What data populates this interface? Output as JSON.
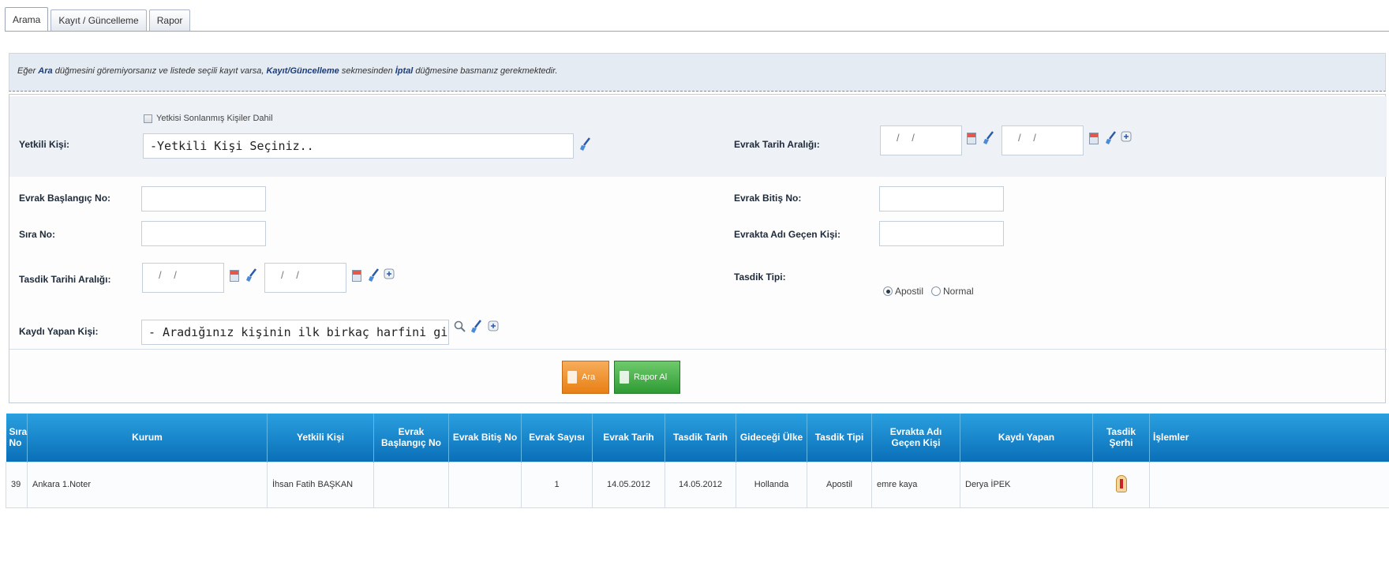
{
  "tabs": [
    "Arama",
    "Kayıt / Güncelleme",
    "Rapor"
  ],
  "info": {
    "t1": "Eğer ",
    "b1": "Ara",
    "t2": " düğmesini göremiyorsanız ve listede seçili kayıt varsa, ",
    "b2": "Kayıt/Güncelleme",
    "t3": " sekmesinden ",
    "b3": "İptal",
    "t4": " düğmesine basmanız gerekmektedir."
  },
  "form": {
    "yetkili_checkbox_label": "Yetkisi Sonlanmış Kişiler Dahil",
    "yetkili_label": "Yetkili Kişi:",
    "yetkili_value": "-Yetkili Kişi Seçiniz..",
    "evrak_tarih_label": "Evrak Tarih Aralığı:",
    "evrak_baslangic_label": "Evrak Başlangıç No:",
    "evrak_bitis_label": "Evrak Bitiş No:",
    "sira_label": "Sıra No:",
    "adi_gecen_label": "Evrakta Adı Geçen Kişi:",
    "tasdik_tarih_label": "Tasdik Tarihi Aralığı:",
    "tasdik_tipi_label": "Tasdik Tipi:",
    "tasdik_options": [
      "Apostil",
      "Normal"
    ],
    "tasdik_selected": "Apostil",
    "kaydi_yapan_label": "Kaydı Yapan Kişi:",
    "kaydi_yapan_value": "- Aradığınız kişinin ilk birkaç harfini giriniz...",
    "date_placeholder": "/ /"
  },
  "buttons": {
    "search": "Ara",
    "report": "Rapor Al"
  },
  "table": {
    "headers": [
      "Sıra No",
      "Kurum",
      "Yetkili Kişi",
      "Evrak Başlangıç No",
      "Evrak Bitiş No",
      "Evrak Sayısı",
      "Evrak Tarih",
      "Tasdik Tarih",
      "Gideceği Ülke",
      "Tasdik Tipi",
      "Evrakta Adı Geçen Kişi",
      "Kaydı Yapan",
      "Tasdik Şerhi",
      "İşlemler"
    ],
    "rows": [
      [
        "39",
        "Ankara 1.Noter",
        "İhsan Fatih BAŞKAN",
        "",
        "",
        "1",
        "14.05.2012",
        "14.05.2012",
        "Hollanda",
        "Apostil",
        "emre kaya",
        "Derya İPEK",
        "",
        ""
      ]
    ]
  },
  "icons": [
    "calendar-icon",
    "clear-brush-icon",
    "add-icon",
    "search-icon",
    "certificate-icon"
  ]
}
